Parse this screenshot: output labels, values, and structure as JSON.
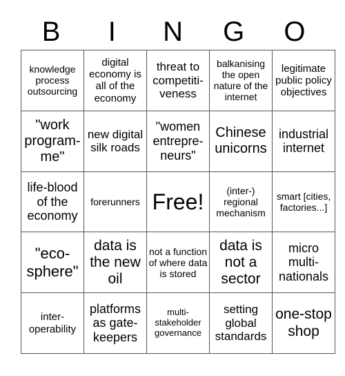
{
  "header": {
    "letters": [
      "B",
      "I",
      "N",
      "G",
      "O"
    ]
  },
  "cells": [
    [
      "knowledge process outsourcing",
      "digital economy is all of the economy",
      "threat to competiti-veness",
      "balkanising the open nature of the internet",
      "legitimate public policy objectives"
    ],
    [
      "\"work program-me\"",
      "new digital silk roads",
      "\"women entrepre-neurs\"",
      "Chinese unicorns",
      "industrial internet"
    ],
    [
      "life-blood of the economy",
      "forerunners",
      "Free!",
      "(inter-) regional mechanism",
      "smart [cities, factories...]"
    ],
    [
      "\"eco-sphere\"",
      "data is the new oil",
      "not a function of where data is stored",
      "data is not a sector",
      "micro multi-nationals"
    ],
    [
      "inter-operability",
      "platforms as gate-keepers",
      "multi-stakeholder governance",
      "setting global standards",
      "one-stop shop"
    ]
  ]
}
